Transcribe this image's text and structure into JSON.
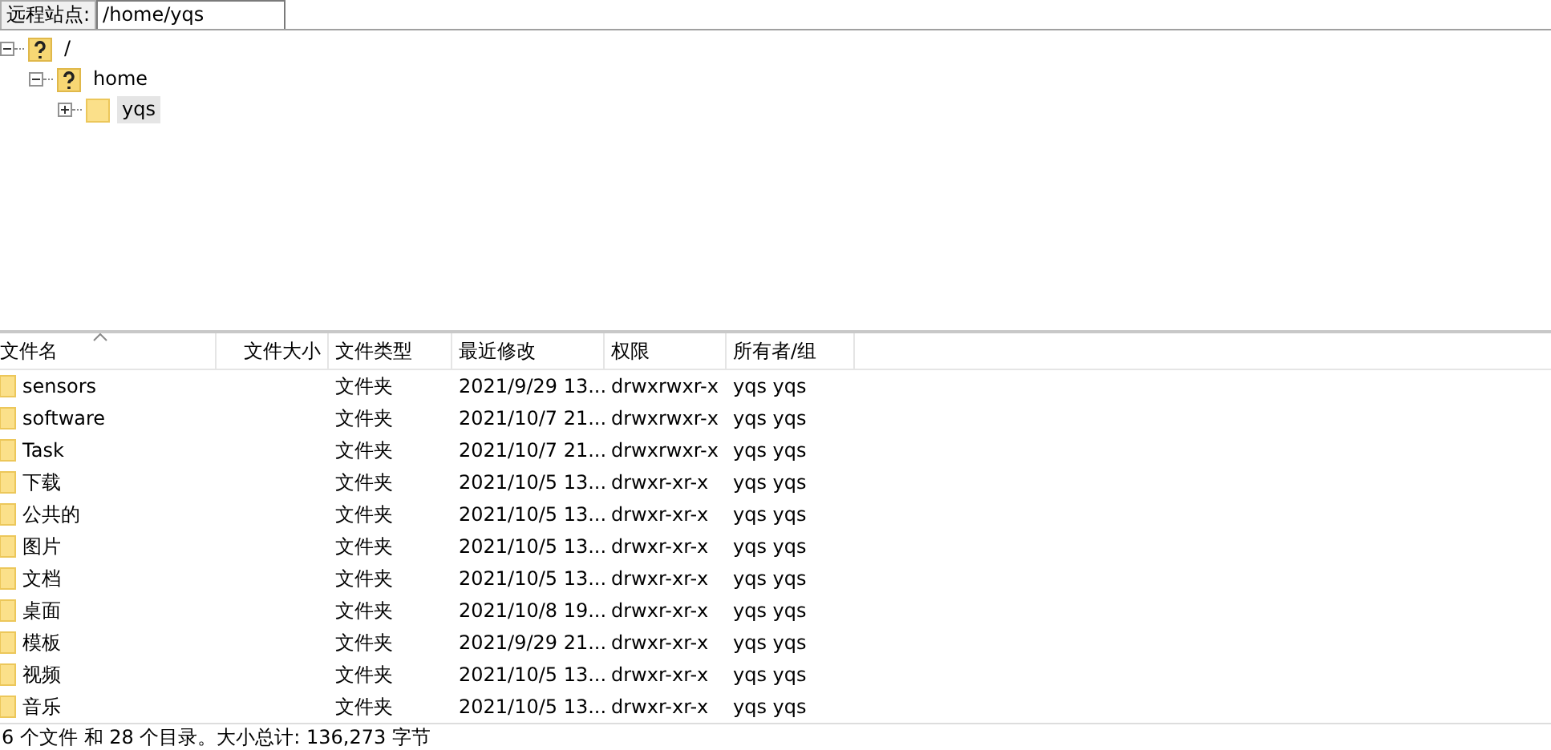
{
  "site_bar": {
    "label": "远程站点:",
    "path": "/home/yqs"
  },
  "tree": [
    {
      "name": "/",
      "kind": "unknown",
      "expanded": true,
      "selected": false,
      "children": [
        {
          "name": "home",
          "kind": "unknown",
          "expanded": true,
          "selected": false,
          "children": [
            {
              "name": "yqs",
              "kind": "folder",
              "expanded": false,
              "selected": true
            }
          ]
        }
      ]
    }
  ],
  "table": {
    "columns": [
      {
        "label": "文件名",
        "sorted": true
      },
      {
        "label": "文件大小",
        "sorted": false
      },
      {
        "label": "文件类型",
        "sorted": false
      },
      {
        "label": "最近修改",
        "sorted": false
      },
      {
        "label": "权限",
        "sorted": false
      },
      {
        "label": "所有者/组",
        "sorted": false
      }
    ],
    "rows": [
      [
        "sensors",
        "",
        "文件夹",
        "2021/9/29 13...",
        "drwxrwxr-x",
        "yqs yqs"
      ],
      [
        "software",
        "",
        "文件夹",
        "2021/10/7 21...",
        "drwxrwxr-x",
        "yqs yqs"
      ],
      [
        "Task",
        "",
        "文件夹",
        "2021/10/7 21...",
        "drwxrwxr-x",
        "yqs yqs"
      ],
      [
        "下载",
        "",
        "文件夹",
        "2021/10/5 13...",
        "drwxr-xr-x",
        "yqs yqs"
      ],
      [
        "公共的",
        "",
        "文件夹",
        "2021/10/5 13...",
        "drwxr-xr-x",
        "yqs yqs"
      ],
      [
        "图片",
        "",
        "文件夹",
        "2021/10/5 13...",
        "drwxr-xr-x",
        "yqs yqs"
      ],
      [
        "文档",
        "",
        "文件夹",
        "2021/10/5 13...",
        "drwxr-xr-x",
        "yqs yqs"
      ],
      [
        "桌面",
        "",
        "文件夹",
        "2021/10/8 19...",
        "drwxr-xr-x",
        "yqs yqs"
      ],
      [
        "模板",
        "",
        "文件夹",
        "2021/9/29 21...",
        "drwxr-xr-x",
        "yqs yqs"
      ],
      [
        "视频",
        "",
        "文件夹",
        "2021/10/5 13...",
        "drwxr-xr-x",
        "yqs yqs"
      ],
      [
        "音乐",
        "",
        "文件夹",
        "2021/10/5 13...",
        "drwxr-xr-x",
        "yqs yqs"
      ]
    ]
  },
  "status_bar": "6 个文件 和 28 个目录。大小总计: 136,273 字节"
}
